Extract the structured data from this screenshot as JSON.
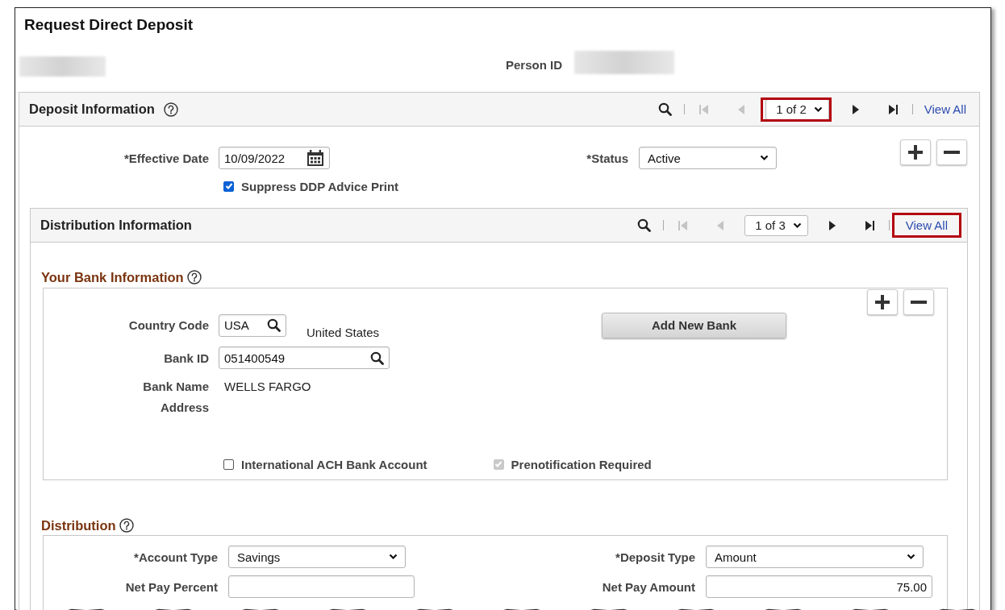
{
  "page": {
    "title": "Request Direct Deposit",
    "person_id_label": "Person ID"
  },
  "deposit_information": {
    "title": "Deposit Information",
    "pager": {
      "at_first": true,
      "page": "1 of 2",
      "page_highlighted": true,
      "view_all": "View All",
      "view_all_highlighted": false
    },
    "effective_date": {
      "label": "*Effective Date",
      "value": "10/09/2022"
    },
    "status": {
      "label": "*Status",
      "value": "Active"
    },
    "suppress_advice": {
      "label": "Suppress DDP Advice Print",
      "checked": true,
      "disabled": false
    },
    "distribution_information": {
      "title": "Distribution Information",
      "pager": {
        "at_first": true,
        "page": "1 of 3",
        "page_highlighted": false,
        "view_all": "View All",
        "view_all_highlighted": true
      },
      "bank": {
        "title": "Your Bank Information",
        "country_code": {
          "label": "Country Code",
          "value": "USA"
        },
        "country_name": "United States",
        "add_button": "Add New Bank",
        "bank_id": {
          "label": "Bank ID",
          "value": "051400549"
        },
        "bank_name": {
          "label": "Bank Name",
          "value": "WELLS FARGO"
        },
        "address_label": "Address",
        "international_ach": {
          "label": "International ACH Bank Account",
          "checked": false,
          "disabled": false
        },
        "prenotification": {
          "label": "Prenotification Required",
          "checked": true,
          "disabled": true
        }
      },
      "distribution": {
        "title": "Distribution",
        "account_type": {
          "label": "*Account Type",
          "value": "Savings"
        },
        "deposit_type": {
          "label": "*Deposit Type",
          "value": "Amount"
        },
        "net_pay_percent": {
          "label": "Net Pay Percent"
        },
        "net_pay_amount": {
          "label": "Net Pay Amount",
          "value": "75.00"
        }
      }
    }
  }
}
